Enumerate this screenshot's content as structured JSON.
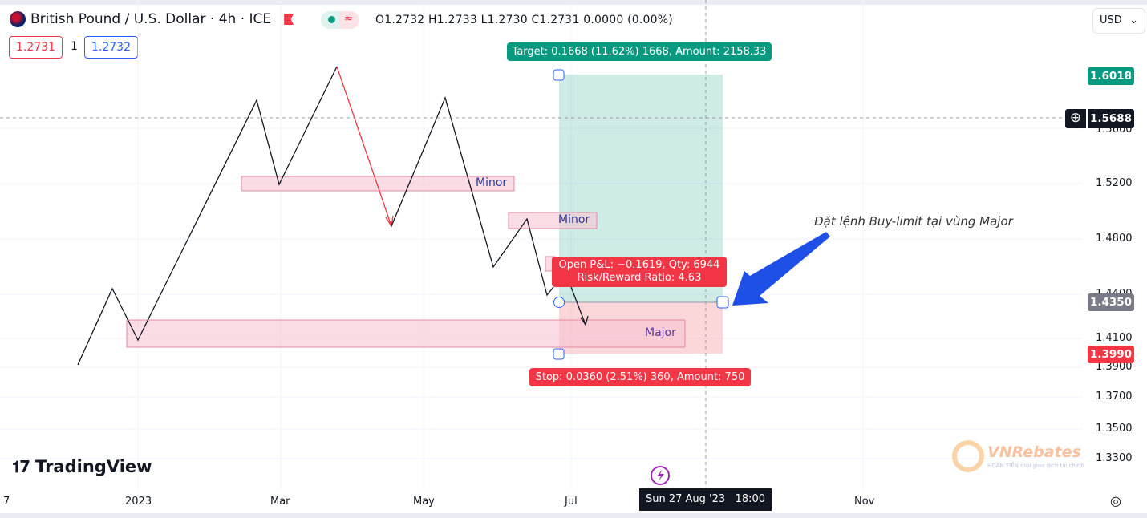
{
  "header": {
    "symbol": "British Pound / U.S. Dollar · 4h · ICE",
    "ohlc": "O1.2732 H1.2733 L1.2730 C1.2731 0.0000 (0.00%)",
    "bid": "1.2731",
    "spread": "1",
    "ask": "1.2732",
    "status_glyph": "≈"
  },
  "currency": {
    "label": "USD",
    "chevron": "⌄"
  },
  "price_axis": {
    "ticks": [
      "1.5600",
      "1.5200",
      "1.4800",
      "1.4400",
      "1.4100",
      "1.3900",
      "1.3700",
      "1.3500",
      "1.3300"
    ],
    "tags": {
      "target": "1.6018",
      "crosshair": "1.5688",
      "entry": "1.4350",
      "stop": "1.3990"
    },
    "colors": {
      "target": "#089981",
      "entry": "#787b86",
      "stop": "#f23645",
      "crosshair": "#131722"
    }
  },
  "time_axis": {
    "ticks": [
      "7",
      "2023",
      "Mar",
      "May",
      "Jul",
      "Nov"
    ],
    "crosshair": "Sun 27 Aug '23   18:00"
  },
  "position": {
    "target_label": "Target: 0.1668 (11.62%) 1668, Amount: 2158.33",
    "pnl_line1": "Open P&L: −0.1619, Qty: 6944",
    "pnl_line2": "Risk/Reward Ratio: 4.63",
    "stop_label": "Stop: 0.0360 (2.51%) 360, Amount: 750"
  },
  "zones": {
    "minor1": "Minor",
    "minor2": "Minor",
    "major": "Major"
  },
  "annotation": "Đặt lệnh Buy-limit tại vùng Major",
  "branding": {
    "logo": "TradingView",
    "watermark": "VNRebates",
    "watermark_sub": "HOÀN TIỀN mọi giao dịch tài chính"
  }
}
